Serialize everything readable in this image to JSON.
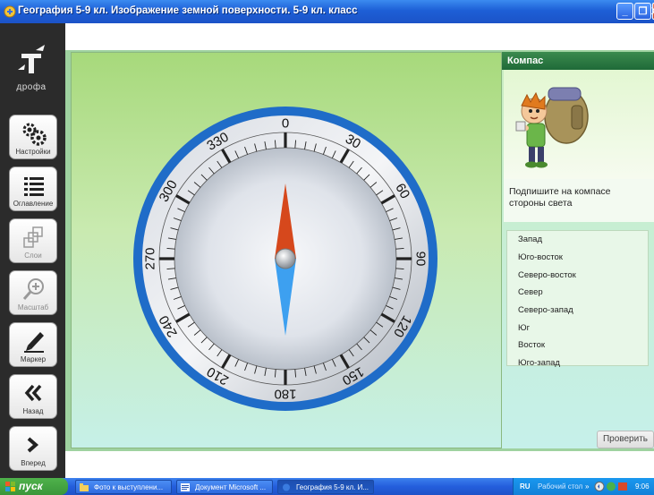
{
  "window": {
    "title": "География 5-9 кл. Изображение земной поверхности. 5-9 кл. класс",
    "min_symbol": "_",
    "max_symbol": "❐",
    "close_symbol": "X"
  },
  "logo": {
    "text": "дрофа"
  },
  "toolbar": {
    "items": [
      {
        "label": "Настройки",
        "icon": "gear-icon",
        "enabled": true
      },
      {
        "label": "Оглавление",
        "icon": "list-icon",
        "enabled": true
      },
      {
        "label": "Слои",
        "icon": "layers-icon",
        "enabled": false
      },
      {
        "label": "Масштаб",
        "icon": "zoom-icon",
        "enabled": false
      },
      {
        "label": "Маркер",
        "icon": "marker-icon",
        "enabled": true
      },
      {
        "label": "Назад",
        "icon": "back-icon",
        "enabled": true
      },
      {
        "label": "Вперед",
        "icon": "forward-icon",
        "enabled": true
      }
    ]
  },
  "compass": {
    "ring_color": "#1f6cc8",
    "north_color": "#d6481c",
    "south_color": "#3da0f0",
    "labels": [
      {
        "text": "0",
        "angle": 0
      },
      {
        "text": "30",
        "angle": 30
      },
      {
        "text": "60",
        "angle": 60
      },
      {
        "text": "90",
        "angle": 90
      },
      {
        "text": "120",
        "angle": 120
      },
      {
        "text": "150",
        "angle": 150
      },
      {
        "text": "180",
        "angle": 180
      },
      {
        "text": "210",
        "angle": 210
      },
      {
        "text": "240",
        "angle": 240
      },
      {
        "text": "270",
        "angle": 270
      },
      {
        "text": "300",
        "angle": 300
      },
      {
        "text": "330",
        "angle": 330
      }
    ]
  },
  "panel": {
    "header": "Компас",
    "instruction": "Подпишите на компасе стороны света",
    "items": [
      "Запад",
      "Юго-восток",
      "Северо-восток",
      "Север",
      "Северо-запад",
      "Юг",
      "Восток",
      "Юго-запад"
    ],
    "check_button": "Проверить"
  },
  "taskbar": {
    "start": "пуск",
    "tasks": [
      {
        "label": "Фото к выступлени...",
        "active": false
      },
      {
        "label": "Документ Microsoft ...",
        "active": false
      },
      {
        "label": "География 5-9 кл. И...",
        "active": true
      }
    ],
    "lang": "RU",
    "desktop": "Рабочий стол",
    "chevron": "»",
    "clock": "9:06"
  }
}
